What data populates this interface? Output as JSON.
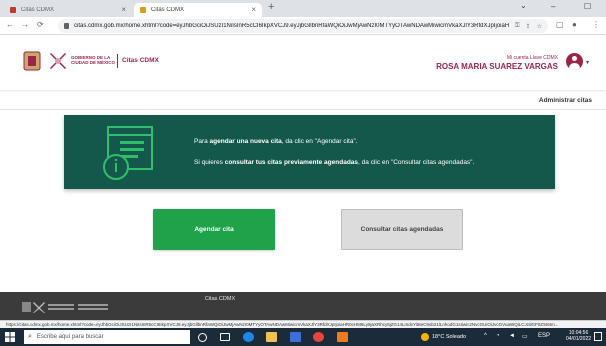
{
  "browser": {
    "tabs": [
      {
        "title": "Citas CDMX",
        "active": false
      },
      {
        "title": "Citas CDMX",
        "active": true
      }
    ],
    "tab_close_glyph": "×",
    "new_tab_glyph": "+",
    "window_controls": [
      "⌄",
      "–",
      "☐"
    ],
    "nav": {
      "back": "←",
      "forward": "→",
      "reload": "⟳"
    },
    "url": "citas.cdmx.gob.mx/home.xhtml?code=eyJhbGciOiJSUzI1NiIsInR5cCI6IkpXVCJ9.eyJjbGllbnRfaWQiOiJwMjAwNzI0MTYyOTAwNDAwMiwicmVkaXJlY3RfdXJpIjoiaHR0cHM6..."
  },
  "header": {
    "logo_text": [
      "GOBIERNO DE LA",
      "CIUDAD DE MÉXICO"
    ],
    "brand": "Citas CDMX",
    "account_label": "Mi cuenta Llave CDMX",
    "user_name": "ROSA MARIA SUAREZ VARGAS",
    "caret": "▾"
  },
  "admin": {
    "link": "Administrar citas"
  },
  "panel": {
    "line1_prefix": "Para ",
    "line1_bold": "agendar una nueva cita",
    "line1_suffix": ", da clic en \"Agendar cita\".",
    "line2_prefix": "Si quieres ",
    "line2_bold": "consultar tus citas previamente agendadas",
    "line2_suffix": ", da clic en \"Consultar citas agendadas\"."
  },
  "buttons": {
    "primary": "Agendar cita",
    "secondary": "Consultar citas agendadas"
  },
  "footer": {
    "title": "Citas CDMX",
    "status_url": "https://citas.cdmx.gob.mx/home.xhtml?code=eyJhbGciOiJSUzI1NiIsInR5cCI6IkpXVCJ9.eyJjbGllbnRfaWQiOiJwMjAwNzI0MTYyOTAwNDAwMiwicmVkaXJlY3RfdXJpIjoiaHR0cHM6Ly9jaXRhcy5jZG14LmdvYi5teC9ob21lLnhodG1sIiwic2NvcGUiOiJvcGVuaWQiLCJzdGF0ZSI6Im..."
  },
  "taskbar": {
    "search_placeholder": "Escribe aquí para buscar",
    "weather": "18°C Soleado",
    "language": "ESP",
    "time": "10:04:56",
    "date": "04/01/2022"
  },
  "colors": {
    "brand": "#9d2449",
    "panel": "#13584a",
    "primary_button": "#1ea34a",
    "footer": "#3b3b3b"
  }
}
